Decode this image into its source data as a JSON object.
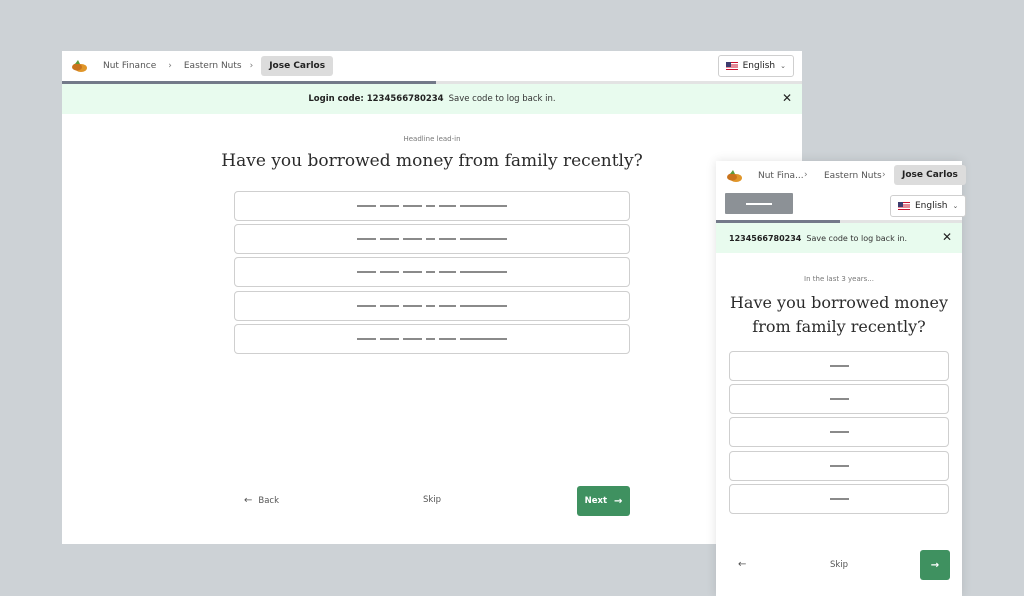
{
  "desktop": {
    "breadcrumbs": [
      "Nut Finance",
      "Eastern Nuts",
      "Jose Carlos"
    ],
    "language": "English",
    "progress_fraction": 0.5,
    "banner": {
      "code_label": "Login code: 1234566780234",
      "message": "Save code to log back in."
    },
    "lead_in": "Headline lead-in",
    "headline": "Have you borrowed money from family recently?",
    "option_count": 5,
    "back_label": "Back",
    "skip_label": "Skip",
    "next_label": "Next"
  },
  "mobile": {
    "breadcrumbs": [
      "Nut Fina...",
      "Eastern Nuts",
      "Jose Carlos"
    ],
    "language": "English",
    "progress_fraction": 0.5,
    "banner": {
      "code_label": "1234566780234",
      "message": "Save code to log back in."
    },
    "lead_in": "In the last 3 years...",
    "headline_line1": "Have you borrowed money",
    "headline_line2": "from family recently?",
    "option_count": 5,
    "skip_label": "Skip"
  },
  "colors": {
    "accent_green": "#3f9160",
    "banner_bg": "#e8fbee",
    "progress_fill": "#737989",
    "page_bg": "#cdd2d6"
  },
  "icons": [
    "nut-logo-icon",
    "chevron-right-icon",
    "us-flag-icon",
    "chevron-down-icon",
    "close-icon",
    "arrow-left-icon",
    "arrow-right-icon"
  ]
}
